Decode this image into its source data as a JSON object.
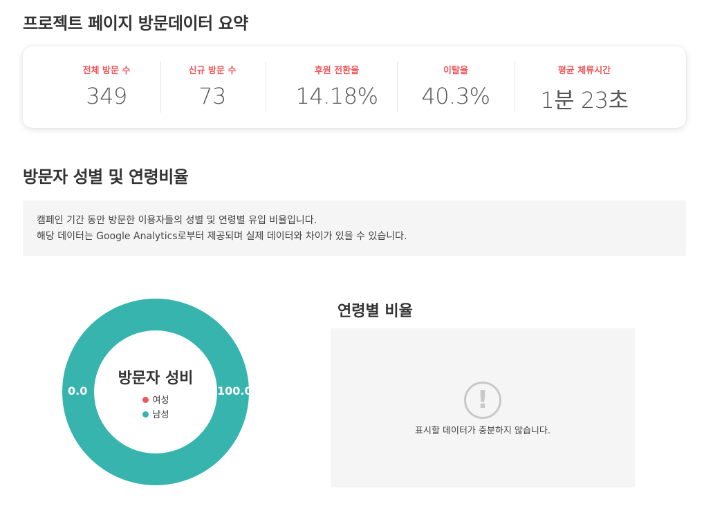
{
  "summary": {
    "title": "프로젝트 페이지 방문데이터 요약",
    "stats": [
      {
        "label": "전체 방문 수",
        "value": "349"
      },
      {
        "label": "신규 방문 수",
        "value": "73"
      },
      {
        "label": "후원 전환율",
        "value": "14.18%"
      },
      {
        "label": "이탈율",
        "value": "40.3%"
      },
      {
        "label": "평균 체류시간",
        "value": "1분 23초"
      }
    ]
  },
  "gender_age": {
    "title": "방문자 성별 및 연령비율",
    "notice": [
      "캠페인 기간 동안 방문한 이용자들의 성별 및 연령별 유입 비율입니다.",
      "해당 데이터는 Google Analytics로부터 제공되며 실제 데이터와 차이가 있을 수 있습니다."
    ]
  },
  "gender_chart": {
    "title": "방문자 성비",
    "legend": [
      {
        "label": "여성",
        "color": "#f0575a"
      },
      {
        "label": "남성",
        "color": "#37b4ae"
      }
    ],
    "female_label": "0.0",
    "male_label": "100.0",
    "ring_color": "#37b4ae"
  },
  "chart_data": {
    "type": "pie",
    "title": "방문자 성비",
    "categories": [
      "여성",
      "남성"
    ],
    "values": [
      0.0,
      100.0
    ],
    "colors": [
      "#f0575a",
      "#37b4ae"
    ]
  },
  "age_chart": {
    "title": "연령별 비율",
    "warning_icon": "exclamation-circle-icon",
    "warning_glyph": "!",
    "message": "표시할 데이터가 충분하지 않습니다."
  }
}
